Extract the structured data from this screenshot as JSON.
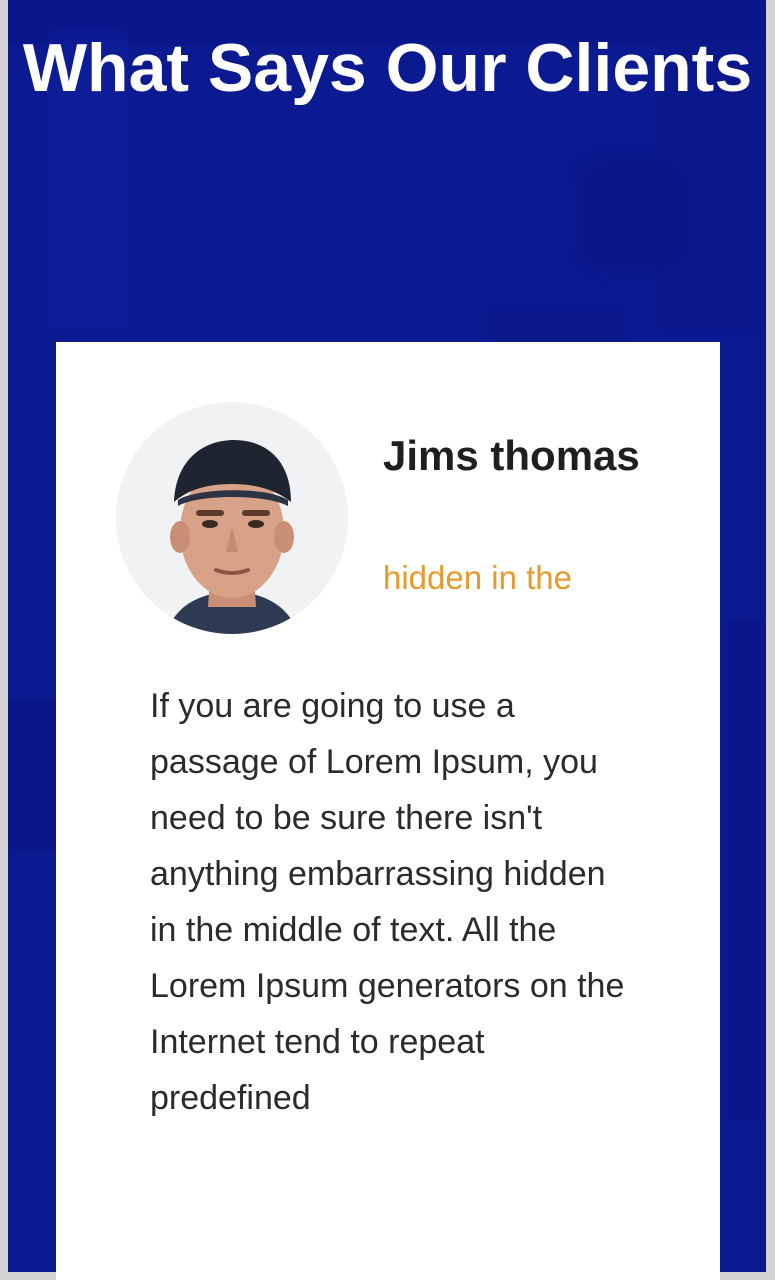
{
  "section": {
    "title": "What Says Our Clients"
  },
  "testimonial": {
    "name": "Jims thomas",
    "role": "hidden in the",
    "text": "If you are going to use a passage of Lorem Ipsum, you need to be sure there isn't anything embarrassing hidden in the middle of text. All the Lorem Ipsum generators on the Internet tend to repeat predefined",
    "avatar_icon": "person-avatar"
  },
  "colors": {
    "section_background": "#0c1a92",
    "card_background": "#ffffff",
    "accent": "#e59a2b",
    "heading_text": "#ffffff"
  }
}
